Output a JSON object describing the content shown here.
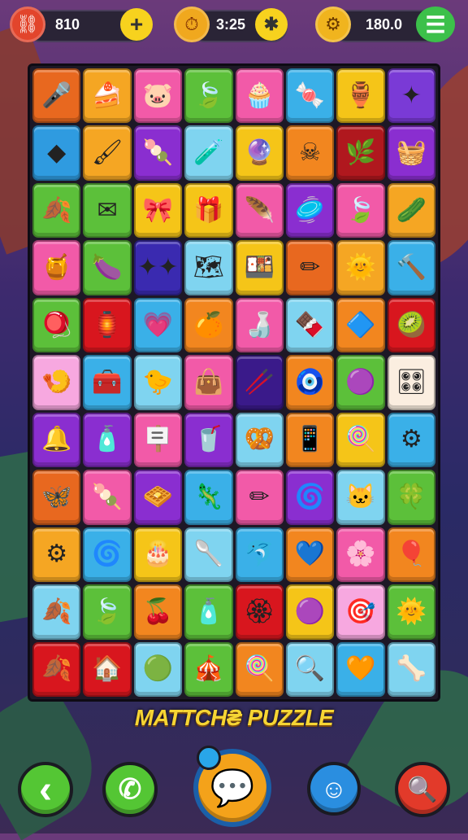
{
  "hud": {
    "left": {
      "value": "810",
      "icon": "lives-icon",
      "button": "+"
    },
    "center": {
      "value": "3:25",
      "icon": "timer-icon",
      "button": "✱"
    },
    "right": {
      "value": "180.0",
      "icon": "coin-icon",
      "button": "☰"
    }
  },
  "board": {
    "rows": [
      [
        {
          "c": "#e8681f",
          "g": "🎤"
        },
        {
          "c": "#f5a623",
          "g": "🍰"
        },
        {
          "c": "#f25aa8",
          "g": "🐷"
        },
        {
          "c": "#5cc03a",
          "g": "🍃"
        },
        {
          "c": "#f25aa8",
          "g": "🧁"
        },
        {
          "c": "#3ab0e8",
          "g": "🍬"
        },
        {
          "c": "#f5c518",
          "g": "🏺"
        },
        {
          "c": "#7a3ad6",
          "g": "✦"
        }
      ],
      [
        {
          "c": "#2f9be0",
          "g": "◆"
        },
        {
          "c": "#f5a623",
          "g": "🖌"
        },
        {
          "c": "#8a2ed0",
          "g": "🍡"
        },
        {
          "c": "#7fd4f0",
          "g": "🧪"
        },
        {
          "c": "#f5c518",
          "g": "🔮"
        },
        {
          "c": "#f2861f",
          "g": "☠"
        },
        {
          "c": "#b0181e",
          "g": "🌿"
        },
        {
          "c": "#8a2ed0",
          "g": "🧺"
        }
      ],
      [
        {
          "c": "#5cc03a",
          "g": "🍂"
        },
        {
          "c": "#5cc03a",
          "g": "✉"
        },
        {
          "c": "#f5c518",
          "g": "🎀"
        },
        {
          "c": "#f5c518",
          "g": "🎁"
        },
        {
          "c": "#f25aa8",
          "g": "🪶"
        },
        {
          "c": "#8a2ed0",
          "g": "🥏"
        },
        {
          "c": "#f25aa8",
          "g": "🍃"
        },
        {
          "c": "#f5a623",
          "g": "🥒"
        }
      ],
      [
        {
          "c": "#f25aa8",
          "g": "🍯"
        },
        {
          "c": "#5cc03a",
          "g": "🍆"
        },
        {
          "c": "#3a2ab0",
          "g": "✦✦"
        },
        {
          "c": "#7fd4f0",
          "g": "🗺"
        },
        {
          "c": "#f5c518",
          "g": "🍱"
        },
        {
          "c": "#e8681f",
          "g": "✏"
        },
        {
          "c": "#f5a623",
          "g": "🌞"
        },
        {
          "c": "#3ab0e8",
          "g": "🔨"
        }
      ],
      [
        {
          "c": "#5cc03a",
          "g": "🪀"
        },
        {
          "c": "#d8161e",
          "g": "🏮"
        },
        {
          "c": "#3ab0e8",
          "g": "💗"
        },
        {
          "c": "#f2861f",
          "g": "🍊"
        },
        {
          "c": "#f25aa8",
          "g": "🍶"
        },
        {
          "c": "#7fd4f0",
          "g": "🍫"
        },
        {
          "c": "#f2861f",
          "g": "🔷"
        },
        {
          "c": "#d8161e",
          "g": "🥝"
        }
      ],
      [
        {
          "c": "#f7a8e0",
          "g": "🍤"
        },
        {
          "c": "#3ab0e8",
          "g": "🧰"
        },
        {
          "c": "#7fd4f0",
          "g": "🐤"
        },
        {
          "c": "#f25aa8",
          "g": "👜"
        },
        {
          "c": "#3a1a8a",
          "g": "🥢"
        },
        {
          "c": "#f2861f",
          "g": "🧿"
        },
        {
          "c": "#5cc03a",
          "g": "🟣"
        },
        {
          "c": "#fbeee0",
          "g": "🎛"
        }
      ],
      [
        {
          "c": "#8a2ed0",
          "g": "🔔"
        },
        {
          "c": "#8a2ed0",
          "g": "🧴"
        },
        {
          "c": "#f25aa8",
          "g": "🪧"
        },
        {
          "c": "#8a2ed0",
          "g": "🥤"
        },
        {
          "c": "#7fd4f0",
          "g": "🥨"
        },
        {
          "c": "#f2861f",
          "g": "📱"
        },
        {
          "c": "#f5c518",
          "g": "🍭"
        },
        {
          "c": "#3ab0e8",
          "g": "⚙"
        }
      ],
      [
        {
          "c": "#e8681f",
          "g": "🦋"
        },
        {
          "c": "#f25aa8",
          "g": "🍡"
        },
        {
          "c": "#8a2ed0",
          "g": "🧇"
        },
        {
          "c": "#3ab0e8",
          "g": "🦎"
        },
        {
          "c": "#f25aa8",
          "g": "✏"
        },
        {
          "c": "#8a2ed0",
          "g": "🌀"
        },
        {
          "c": "#7fd4f0",
          "g": "🐱"
        },
        {
          "c": "#5cc03a",
          "g": "🍀"
        }
      ],
      [
        {
          "c": "#f5a623",
          "g": "⚙"
        },
        {
          "c": "#3ab0e8",
          "g": "🌀"
        },
        {
          "c": "#f5c518",
          "g": "🎂"
        },
        {
          "c": "#7fd4f0",
          "g": "🥄"
        },
        {
          "c": "#3ab0e8",
          "g": "🐬"
        },
        {
          "c": "#f2861f",
          "g": "💙"
        },
        {
          "c": "#f25aa8",
          "g": "🌸"
        },
        {
          "c": "#f2861f",
          "g": "🎈"
        }
      ],
      [
        {
          "c": "#7fd4f0",
          "g": "🍂"
        },
        {
          "c": "#5cc03a",
          "g": "🍃"
        },
        {
          "c": "#f2861f",
          "g": "🍒"
        },
        {
          "c": "#5cc03a",
          "g": "🧴"
        },
        {
          "c": "#d8161e",
          "g": "🏵"
        },
        {
          "c": "#f5c518",
          "g": "🟣"
        },
        {
          "c": "#f7a8e0",
          "g": "🎯"
        },
        {
          "c": "#5cc03a",
          "g": "🌞"
        }
      ],
      [
        {
          "c": "#d8161e",
          "g": "🍂"
        },
        {
          "c": "#d8161e",
          "g": "🏠"
        },
        {
          "c": "#7fd4f0",
          "g": "🟢"
        },
        {
          "c": "#5cc03a",
          "g": "🎪"
        },
        {
          "c": "#f2861f",
          "g": "🍭"
        },
        {
          "c": "#7fd4f0",
          "g": "🔍"
        },
        {
          "c": "#3ab0e8",
          "g": "🧡"
        },
        {
          "c": "#7fd4f0",
          "g": "🦴"
        }
      ]
    ]
  },
  "title": "MATTCH₴ PUZZLE",
  "bottom": {
    "back": "‹",
    "phone": "✆",
    "center": "💬",
    "chat": "☺",
    "search": "🔍"
  }
}
